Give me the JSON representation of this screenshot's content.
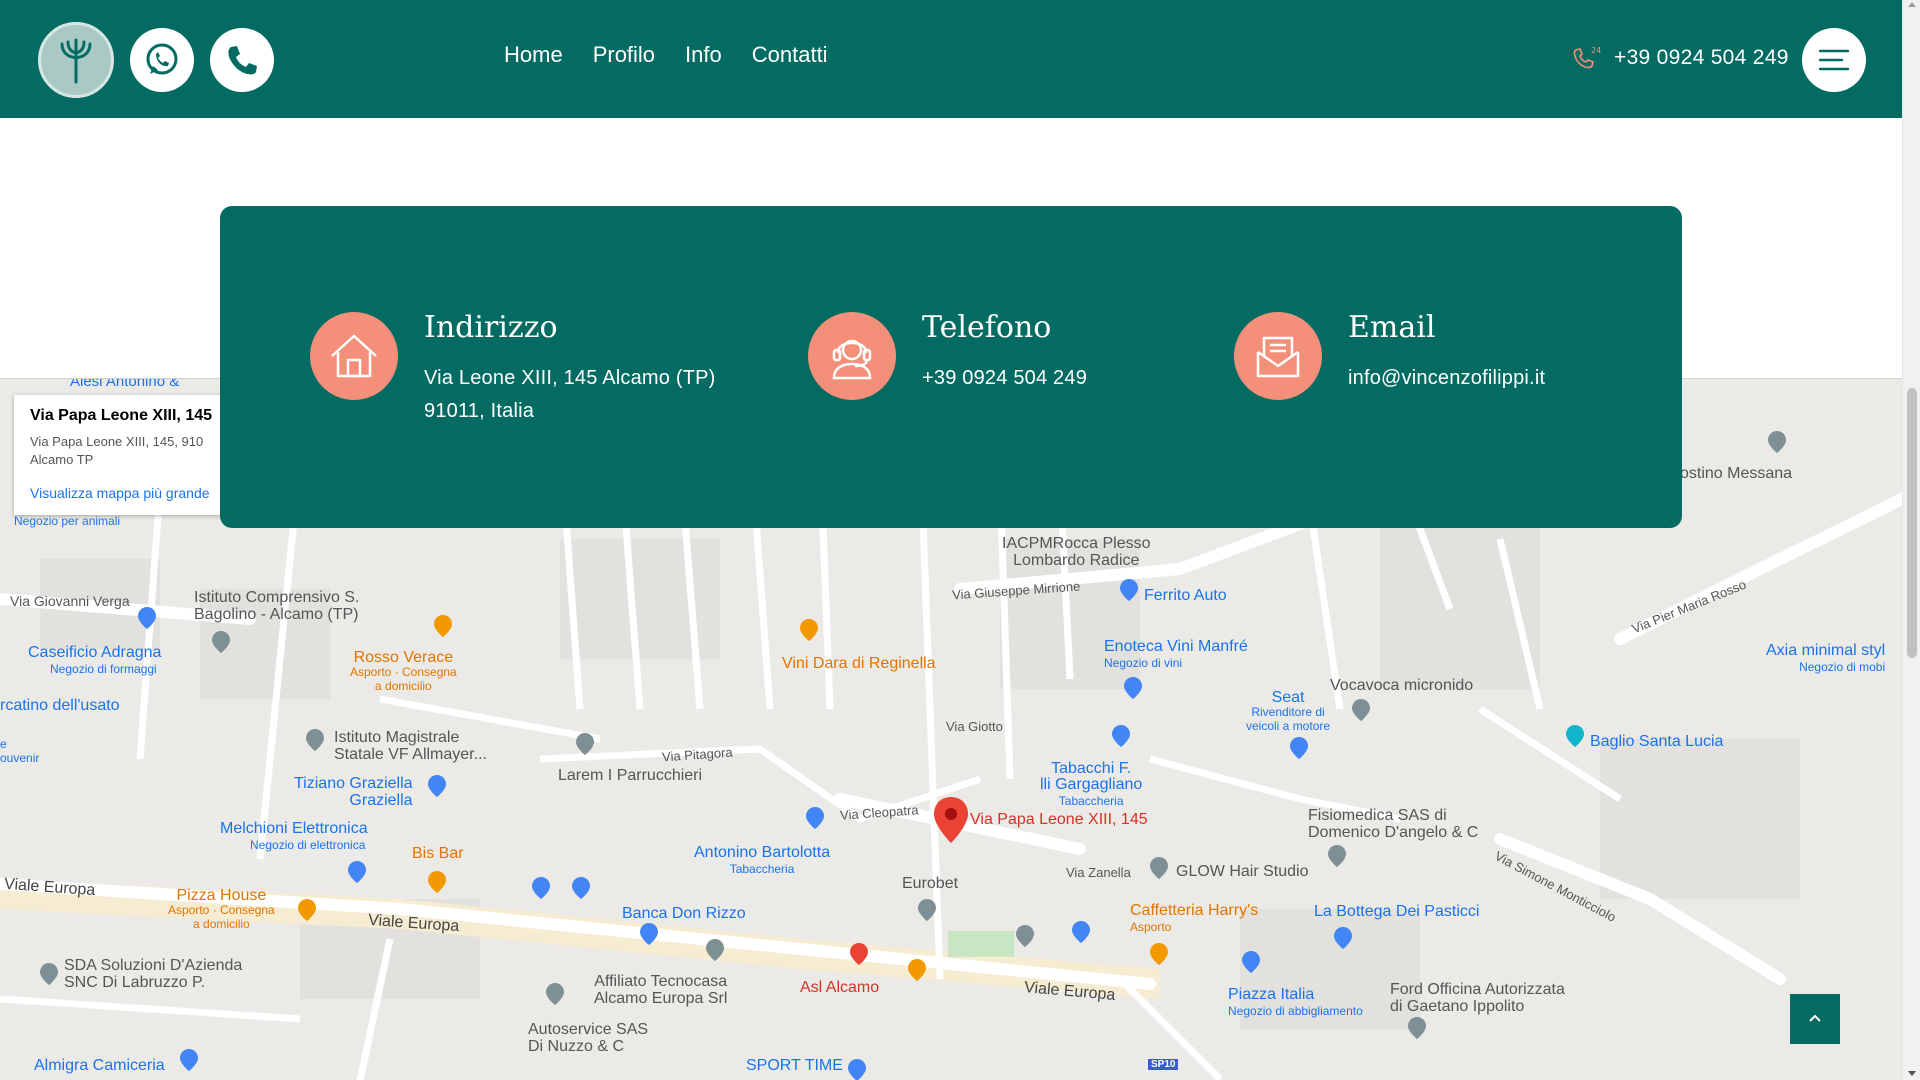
{
  "header": {
    "nav": [
      "Home",
      "Profilo",
      "Info",
      "Contatti"
    ],
    "phone": "+39 0924 504 249",
    "icons": {
      "logo": "trident-logo-icon",
      "whatsapp": "whatsapp-icon",
      "call": "phone-icon",
      "phone24": "phone-24h-icon",
      "menu": "hamburger-menu-icon"
    }
  },
  "contact": {
    "address": {
      "title": "Indirizzo",
      "line1": "Via Leone XIII, 145 Alcamo (TP)",
      "line2": "91011, Italia",
      "icon": "house-icon"
    },
    "phone": {
      "title": "Telefono",
      "line1": "+39 0924 504 249",
      "icon": "headset-icon"
    },
    "email": {
      "title": "Email",
      "line1": "info@vincenzofilippi.it",
      "icon": "envelope-icon"
    }
  },
  "map": {
    "card": {
      "title": "Via Papa Leone XIII, 145",
      "address_line1": "Via Papa Leone XIII, 145, 910",
      "address_line2": "Alcamo TP",
      "link": "Visualizza mappa più grande"
    },
    "marker_label": "Via Papa Leone XIII, 145",
    "labels": {
      "alesi": "Alesi Antonino &",
      "negozio_animali": "Negozio per animali",
      "via_giovanni_verga": "Via Giovanni Verga",
      "istituto_comprensivo": "Istituto Comprensivo S.",
      "istituto_comprensivo2": "Bagolino - Alcamo (TP)",
      "caseificio": "Caseificio Adragna",
      "caseificio_sub": "Negozio di formaggi",
      "mercatino": "rcatino dell'usato",
      "souvenir1": "e",
      "souvenir2": "ouvenir",
      "rosso_verace": "Rosso Verace",
      "rosso_verace_sub1": "Asporto · Consegna",
      "rosso_verace_sub2": "a domicilio",
      "istituto_magistrale": "Istituto Magistrale",
      "istituto_magistrale2": "Statale VF Allmayer...",
      "tiziano1": "Tiziano Graziella",
      "tiziano2": "Graziella",
      "melchioni": "Melchioni Elettronica",
      "melchioni_sub": "Negozio di elettronica",
      "bis_bar": "Bis Bar",
      "pizza_house": "Pizza House",
      "pizza_house_sub1": "Asporto · Consegna",
      "pizza_house_sub2": "a domicilio",
      "viale_europa_w": "Viale Europa",
      "viale_europa_c": "Viale Europa",
      "viale_europa_e": "Viale Europa",
      "sda1": "SDA Soluzioni D'Azienda",
      "sda2": "SNC Di Labruzzo P.",
      "almigra": "Almigra Camiceria",
      "larem": "Larem I Parrucchieri",
      "vini_dara": "Vini Dara di Reginella",
      "via_pitagora": "Via Pitagora",
      "iacp1": "IACPMRocca Plesso",
      "iacp2": "Lombardo Radice",
      "via_giuseppe_mirrione": "Via Giuseppe Mirrione",
      "ferrito": "Ferrito Auto",
      "enoteca": "Enoteca Vini Manfré",
      "enoteca_sub": "Negozio di vini",
      "vocavoca": "Vocavoca micronido",
      "seat": "Seat",
      "seat_sub1": "Rivenditore di",
      "seat_sub2": "veicoli a motore",
      "via_giotto": "Via Giotto",
      "tabacchi1": "Tabacchi F.",
      "tabacchi2": "lli Gargagliano",
      "tabacchi_sub": "Tabaccheria",
      "via_cleopatra": "Via Cleopatra",
      "antonino": "Antonino Bartolotta",
      "antonino_sub": "Tabaccheria",
      "eurobet": "Eurobet",
      "via_zanella": "Via Zanella",
      "glow": "GLOW Hair Studio",
      "fisiomedica1": "Fisiomedica SAS di",
      "fisiomedica2": "Domenico D'angelo & C",
      "banca": "Banca Don Rizzo",
      "caffetteria": "Caffetteria Harry's",
      "caffetteria_sub": "Asporto",
      "bottega": "La Bottega Dei Pasticci",
      "affiliato1": "Affiliato Tecnocasa",
      "affiliato2": "Alcamo Europa Srl",
      "asl": "Asl Alcamo",
      "autoservice1": "Autoservice SAS",
      "autoservice2": "Di Nuzzo & C",
      "sport_time": "SPORT TIME",
      "piazza_italia": "Piazza Italia",
      "piazza_italia_sub": "Negozio di abbigliamento",
      "ford1": "Ford Officina Autorizzata",
      "ford2": "di Gaetano Ippolito",
      "baglio": "Baglio Santa Lucia",
      "axia": "Axia minimal styl",
      "axia_sub": "Negozio di mobi",
      "agostino": "ostino Messana",
      "via_pier_maria_rosso": "Via Pier Maria Rosso",
      "via_simone_monticciolo": "Via Simone Monticciolo",
      "sp10": "SP10"
    }
  },
  "scroll_top_icon": "chevron-up-icon"
}
